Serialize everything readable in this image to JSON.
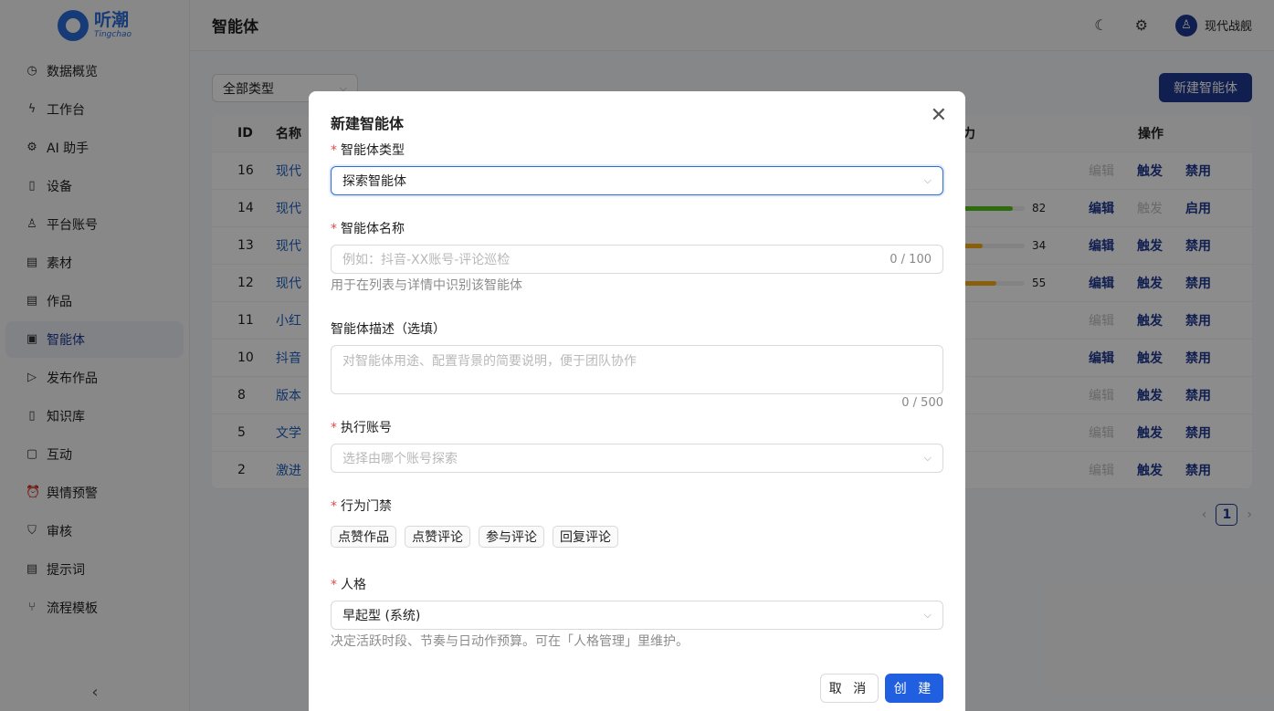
{
  "app": {
    "logo_cn": "听潮",
    "logo_en": "Tingchao",
    "page_title": "智能体",
    "user_name": "现代战舰"
  },
  "sidebar": {
    "items": [
      {
        "label": "数据概览",
        "icon": "dashboard-icon",
        "glyph": "◷"
      },
      {
        "label": "工作台",
        "icon": "lightning-icon",
        "glyph": "ϟ"
      },
      {
        "label": "AI 助手",
        "icon": "ai-icon",
        "glyph": "⚙"
      },
      {
        "label": "设备",
        "icon": "phone-icon",
        "glyph": "▯"
      },
      {
        "label": "平台账号",
        "icon": "account-icon",
        "glyph": "♙"
      },
      {
        "label": "素材",
        "icon": "file-icon",
        "glyph": "▤"
      },
      {
        "label": "作品",
        "icon": "document-icon",
        "glyph": "▤"
      },
      {
        "label": "智能体",
        "icon": "agent-icon",
        "glyph": "▣",
        "active": true
      },
      {
        "label": "发布作品",
        "icon": "send-icon",
        "glyph": "▷"
      },
      {
        "label": "知识库",
        "icon": "book-icon",
        "glyph": "▯"
      },
      {
        "label": "互动",
        "icon": "chat-icon",
        "glyph": "▢"
      },
      {
        "label": "舆情预警",
        "icon": "alarm-icon",
        "glyph": "⏰"
      },
      {
        "label": "审核",
        "icon": "shield-icon",
        "glyph": "⛉"
      },
      {
        "label": "提示词",
        "icon": "prompt-icon",
        "glyph": "▤"
      },
      {
        "label": "流程模板",
        "icon": "branch-icon",
        "glyph": "⑂"
      }
    ],
    "collapse_glyph": "‹"
  },
  "toolbar": {
    "filter_value": "全部类型",
    "new_button": "新建智能体"
  },
  "table": {
    "headers": {
      "id": "ID",
      "name": "名称",
      "ability": "力",
      "ops": "操作"
    },
    "rows": [
      {
        "id": "16",
        "name": "现代",
        "bar": null,
        "ops": [
          "编辑",
          "触发",
          "禁用"
        ],
        "enabled": [
          false,
          true,
          true
        ]
      },
      {
        "id": "14",
        "name": "现代",
        "bar": {
          "value": "82",
          "pct": 82,
          "color": "#52c41a"
        },
        "ops": [
          "编辑",
          "触发",
          "启用"
        ],
        "enabled": [
          true,
          false,
          true
        ]
      },
      {
        "id": "13",
        "name": "现代",
        "bar": {
          "value": "34",
          "pct": 34,
          "color": "#faad14"
        },
        "ops": [
          "编辑",
          "触发",
          "禁用"
        ],
        "enabled": [
          true,
          true,
          true
        ]
      },
      {
        "id": "12",
        "name": "现代",
        "bar": {
          "value": "55",
          "pct": 55,
          "color": "#faad14"
        },
        "ops": [
          "编辑",
          "触发",
          "禁用"
        ],
        "enabled": [
          true,
          true,
          true
        ]
      },
      {
        "id": "11",
        "name": "小红",
        "bar": null,
        "ops": [
          "编辑",
          "触发",
          "禁用"
        ],
        "enabled": [
          false,
          true,
          true
        ]
      },
      {
        "id": "10",
        "name": "抖音",
        "bar": null,
        "ops": [
          "编辑",
          "触发",
          "禁用"
        ],
        "enabled": [
          true,
          true,
          true
        ]
      },
      {
        "id": "8",
        "name": "版本",
        "bar": null,
        "ops": [
          "编辑",
          "触发",
          "禁用"
        ],
        "enabled": [
          false,
          true,
          true
        ]
      },
      {
        "id": "5",
        "name": "文学",
        "bar": null,
        "ops": [
          "编辑",
          "触发",
          "禁用"
        ],
        "enabled": [
          false,
          true,
          true
        ]
      },
      {
        "id": "2",
        "name": "激进",
        "bar": null,
        "ops": [
          "编辑",
          "触发",
          "禁用"
        ],
        "enabled": [
          false,
          true,
          true
        ]
      }
    ],
    "page": "1"
  },
  "modal": {
    "title": "新建智能体",
    "type_label": "智能体类型",
    "type_value": "探索智能体",
    "name_label": "智能体名称",
    "name_placeholder": "例如：抖音-XX账号-评论巡检",
    "name_count": "0 / 100",
    "name_hint": "用于在列表与详情中识别该智能体",
    "desc_label": "智能体描述（选填）",
    "desc_placeholder": "对智能体用途、配置背景的简要说明，便于团队协作",
    "desc_count": "0 / 500",
    "account_label": "执行账号",
    "account_placeholder": "选择由哪个账号探索",
    "gate_label": "行为门禁",
    "gate_tags": [
      "点赞作品",
      "点赞评论",
      "参与评论",
      "回复评论"
    ],
    "persona_label": "人格",
    "persona_value": "早起型 (系统)",
    "persona_hint": "决定活跃时段、节奏与日动作预算。可在「人格管理」里维护。",
    "cancel": "取 消",
    "ok": "创 建"
  },
  "colors": {
    "primary": "#1f3a93",
    "ok_button": "#1f5fe0",
    "required": "#e5484d"
  }
}
